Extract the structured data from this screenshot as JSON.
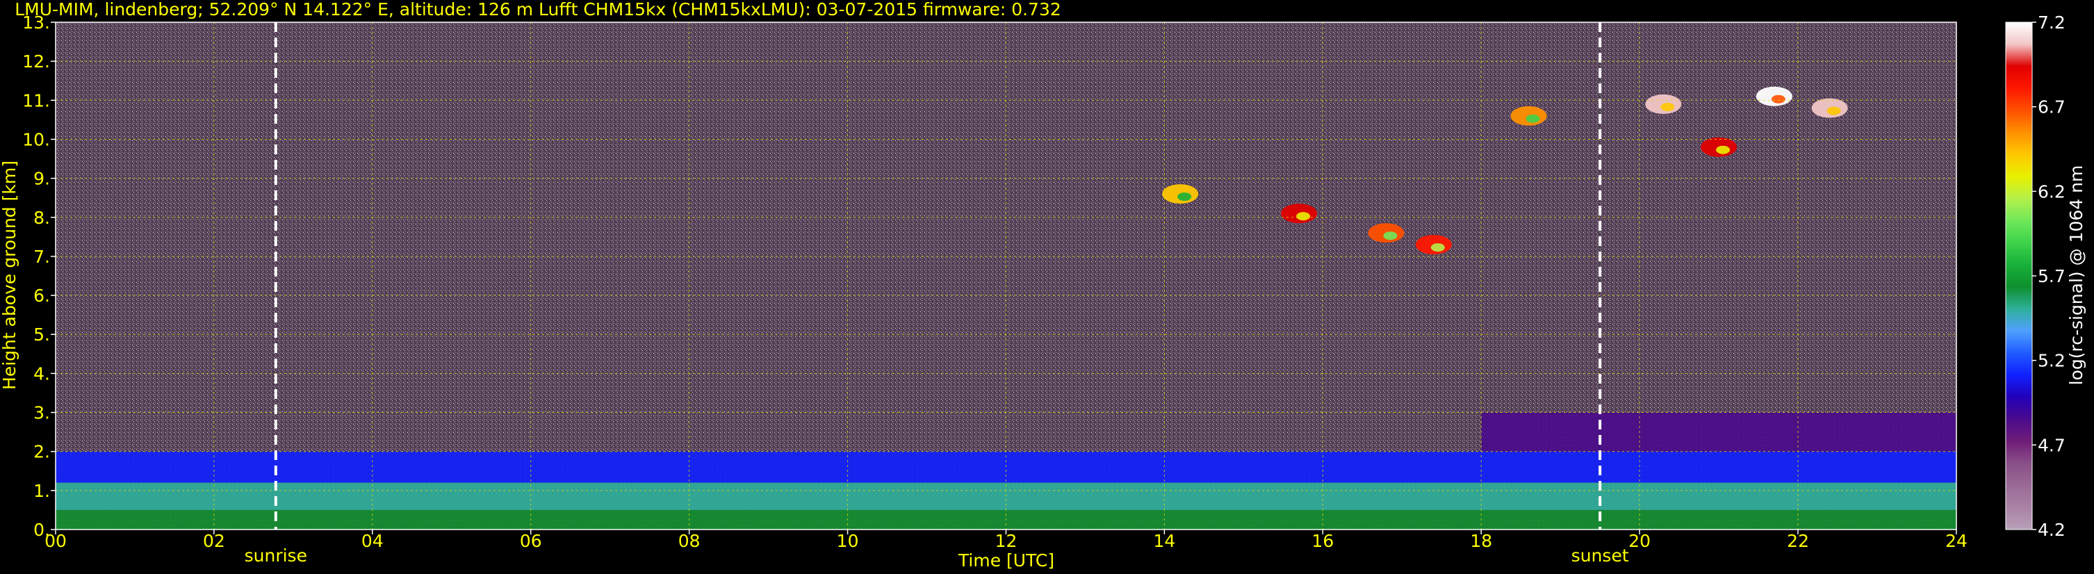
{
  "chart_data": {
    "type": "heatmap",
    "title": "LMU-MIM, lindenberg; 52.209° N 14.122° E, altitude: 126 m    Lufft CHM15kx (CHM15kxLMU): 03-07-2015    firmware: 0.732",
    "xlabel": "Time [UTC]",
    "ylabel": "Height above ground [km]",
    "xlim": [
      0,
      24
    ],
    "ylim": [
      0,
      13
    ],
    "x_ticks": [
      "00",
      "02",
      "04",
      "06",
      "08",
      "10",
      "12",
      "14",
      "16",
      "18",
      "20",
      "22",
      "24"
    ],
    "y_ticks": [
      "0.",
      "1.",
      "2.",
      "3.",
      "4.",
      "5.",
      "6.",
      "7.",
      "8.",
      "9.",
      "10.",
      "11.",
      "12.",
      "13."
    ],
    "grid": true,
    "events": [
      {
        "label": "sunrise",
        "x": 2.78
      },
      {
        "label": "sunset",
        "x": 19.5
      }
    ],
    "colorbar": {
      "label": "log(rc-signal) @ 1064 nm",
      "range": [
        4.2,
        7.2
      ],
      "ticks": [
        "4.2",
        "4.7",
        "5.2",
        "5.7",
        "6.2",
        "6.7",
        "7.2"
      ],
      "colors": [
        "#b8a0b8",
        "#a982a6",
        "#9a6a96",
        "#8a4f88",
        "#6f1d78",
        "#4a0a8c",
        "#2200b8",
        "#1020ff",
        "#1f5bff",
        "#4fa0ff",
        "#2eb09a",
        "#0f8f2e",
        "#18b03a",
        "#3ed24a",
        "#6fe85a",
        "#b4f04a",
        "#e8f000",
        "#ffc800",
        "#ff9000",
        "#ff5000",
        "#ff1800",
        "#e00000",
        "#f2c6c6",
        "#ffffff"
      ]
    },
    "layers": [
      {
        "name": "noise",
        "x": [
          0,
          24
        ],
        "y": [
          2.0,
          13.0
        ],
        "value": 4.5
      },
      {
        "name": "aerosol-upper",
        "x": [
          0,
          24
        ],
        "y": [
          1.2,
          2.0
        ],
        "value": 5.1
      },
      {
        "name": "aerosol-mid",
        "x": [
          0,
          24
        ],
        "y": [
          0.5,
          1.2
        ],
        "value": 5.5
      },
      {
        "name": "aerosol-lower",
        "x": [
          0,
          24
        ],
        "y": [
          0.0,
          0.5
        ],
        "value": 5.6
      },
      {
        "name": "residual-layer-evening",
        "x": [
          18,
          24
        ],
        "y": [
          2.0,
          3.0
        ],
        "value": 4.9
      }
    ],
    "clouds": [
      {
        "x": 15.7,
        "y": 8.1,
        "value": 6.9
      },
      {
        "x": 16.8,
        "y": 7.6,
        "value": 6.6
      },
      {
        "x": 17.4,
        "y": 7.3,
        "value": 6.7
      },
      {
        "x": 14.2,
        "y": 8.6,
        "value": 6.4
      },
      {
        "x": 20.3,
        "y": 10.9,
        "value": 7.0
      },
      {
        "x": 21.7,
        "y": 11.1,
        "value": 7.2
      },
      {
        "x": 22.4,
        "y": 10.8,
        "value": 7.0
      },
      {
        "x": 21.0,
        "y": 9.8,
        "value": 6.9
      },
      {
        "x": 18.6,
        "y": 10.6,
        "value": 6.5
      }
    ]
  }
}
